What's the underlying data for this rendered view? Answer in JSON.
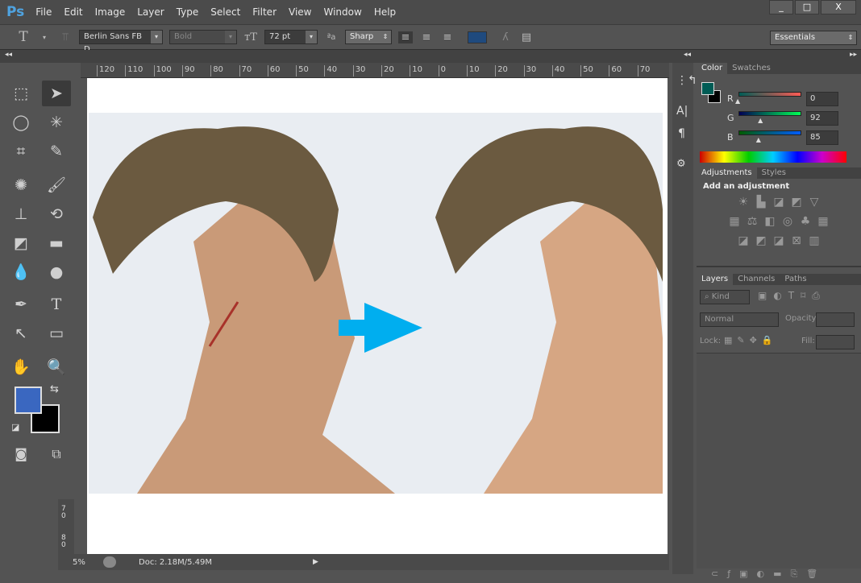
{
  "app": {
    "logo": "Ps"
  },
  "menu": [
    "File",
    "Edit",
    "Image",
    "Layer",
    "Type",
    "Select",
    "Filter",
    "View",
    "Window",
    "Help"
  ],
  "window_controls": [
    "_",
    "□",
    "X"
  ],
  "options": {
    "font_family": "Berlin Sans FB D...",
    "font_style": "Bold",
    "font_size": "72 pt",
    "antialias": "Sharp",
    "text_color": "#1f4a7e",
    "workspace": "Essentials"
  },
  "ruler": {
    "h_labels": [
      "120",
      "110",
      "100",
      "90",
      "80",
      "70",
      "60",
      "50",
      "40",
      "30",
      "20",
      "10",
      "0",
      "10",
      "20",
      "30",
      "40",
      "50",
      "60",
      "70"
    ],
    "v_labels": [
      "7\n0",
      "8\n0"
    ]
  },
  "toolbox": {
    "foreground": "#3a67c0",
    "background": "#000000"
  },
  "status": {
    "zoom": "5%",
    "doc": "Doc: 2.18M/5.49M"
  },
  "color_panel": {
    "tabs": [
      "Color",
      "Swatches"
    ],
    "r_label": "R",
    "g_label": "G",
    "b_label": "B",
    "r": "0",
    "g": "92",
    "b": "85",
    "fg": "#005c55",
    "r_frac": 0,
    "g_frac": 0.36,
    "b_frac": 0.33
  },
  "adjustments": {
    "tabs": [
      "Adjustments",
      "Styles"
    ],
    "heading": "Add an adjustment"
  },
  "layers": {
    "tabs": [
      "Layers",
      "Channels",
      "Paths"
    ],
    "kind": "Kind",
    "blend": "Normal",
    "opacity_label": "Opacity:",
    "lock_label": "Lock:",
    "fill_label": "Fill:"
  },
  "arrow_color": "#00aeef"
}
